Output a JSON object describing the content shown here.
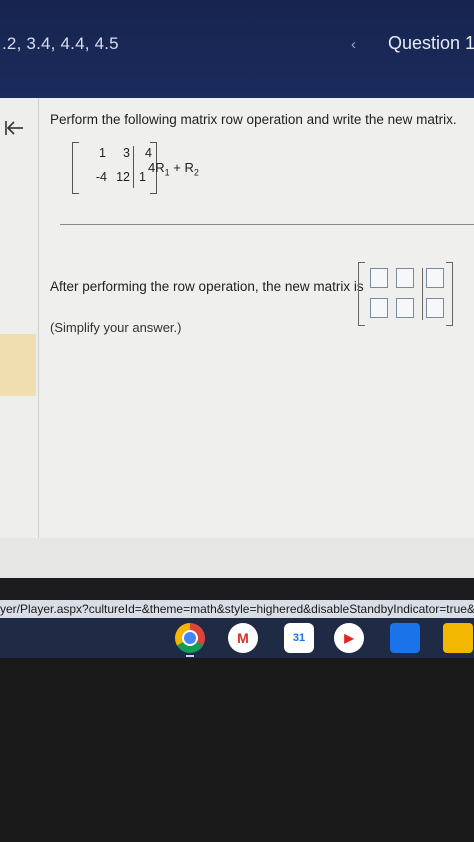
{
  "header": {
    "sections": ".2, 3.4, 4.4, 4.5",
    "prev_glyph": "‹",
    "question_label": "Question 1"
  },
  "problem": {
    "instruction": "Perform the following matrix row operation and write the new matrix.",
    "matrix": {
      "rows": [
        [
          "1",
          "3",
          "4"
        ],
        [
          "-4",
          "12",
          "1"
        ]
      ]
    },
    "operation": {
      "coef": "4R",
      "sub1": "1",
      "plus": " + R",
      "sub2": "2"
    }
  },
  "answer": {
    "prompt": "After performing the row operation, the new matrix is",
    "hint": "(Simplify your answer.)"
  },
  "url_text": "yer/Player.aspx?cultureId=&theme=math&style=highered&disableStandbyIndicator=true&assi",
  "taskbar": {
    "apps": [
      "chrome-icon",
      "gmail-icon",
      "calendar-icon",
      "youtube-icon",
      "files-icon",
      "classroom-icon"
    ],
    "calendar_day": "31",
    "gmail_glyph": "M",
    "youtube_glyph": "▶"
  }
}
